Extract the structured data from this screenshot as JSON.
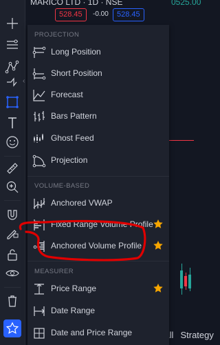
{
  "header": {
    "symbol_title": "MARICO LTD · 1D · NSE",
    "sell_price": "528.45",
    "spread": "-0.00",
    "buy_price": "528.45",
    "right_value": "0525.00"
  },
  "toolbar": {
    "tools": [
      "crosshair-icon",
      "trend-line-icon",
      "fib-icon",
      "pattern-icon",
      "prediction-icon",
      "projection-tool-icon",
      "text-icon",
      "emoji-icon",
      "measure-ruler-icon",
      "zoom-in-icon",
      "magnet-icon",
      "lock-drawing-icon",
      "lock-icon",
      "eye-icon",
      "trash-icon",
      "favorites-star-icon"
    ]
  },
  "menu": {
    "sections": [
      {
        "header": "PROJECTION",
        "items": [
          {
            "label": "Long Position",
            "icon": "long-position-icon",
            "starred": false
          },
          {
            "label": "Short Position",
            "icon": "short-position-icon",
            "starred": false
          },
          {
            "label": "Forecast",
            "icon": "forecast-icon",
            "starred": false
          },
          {
            "label": "Bars Pattern",
            "icon": "bars-pattern-icon",
            "starred": false
          },
          {
            "label": "Ghost Feed",
            "icon": "ghost-feed-icon",
            "starred": false
          },
          {
            "label": "Projection",
            "icon": "projection-icon",
            "starred": false
          }
        ]
      },
      {
        "header": "VOLUME-BASED",
        "items": [
          {
            "label": "Anchored VWAP",
            "icon": "anchored-vwap-icon",
            "starred": false
          },
          {
            "label": "Fixed Range Volume Profile",
            "icon": "fixed-range-volume-profile-icon",
            "starred": true
          },
          {
            "label": "Anchored Volume Profile",
            "icon": "anchored-volume-profile-icon",
            "starred": true
          }
        ]
      },
      {
        "header": "MEASURER",
        "items": [
          {
            "label": "Price Range",
            "icon": "price-range-icon",
            "starred": true
          },
          {
            "label": "Date Range",
            "icon": "date-range-icon",
            "starred": false
          },
          {
            "label": "Date and Price Range",
            "icon": "date-price-range-icon",
            "starred": false
          }
        ]
      }
    ]
  },
  "bottom_tabs": {
    "tab_all": "All",
    "tab_strategy": "Strategy"
  },
  "colors": {
    "menu_bg": "#1e222d",
    "page_bg": "#131722",
    "text": "#d1d4dc",
    "muted": "#787b86",
    "star": "#f7a600",
    "annotation": "#e00000",
    "accent": "#2962ff"
  }
}
